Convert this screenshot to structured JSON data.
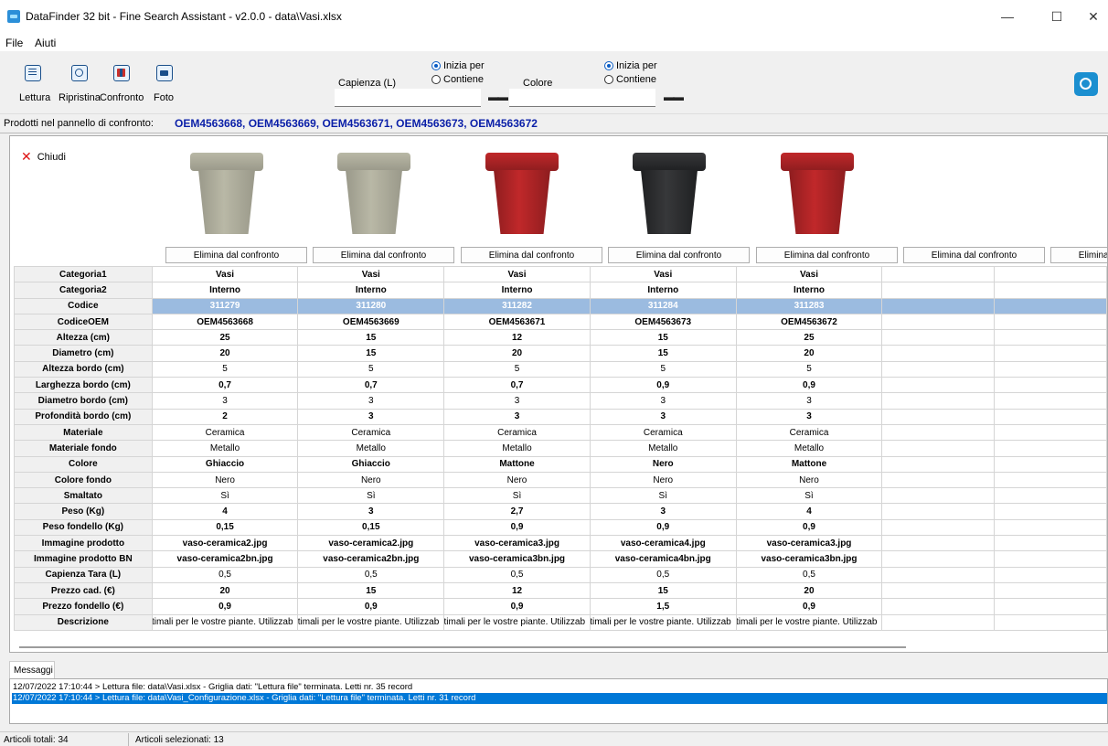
{
  "window": {
    "title": "DataFinder 32 bit - Fine Search Assistant - v2.0.0 - data\\Vasi.xlsx",
    "minimize": "—",
    "maximize": "☐",
    "close": "✕"
  },
  "menu": [
    "File",
    "Aiuti"
  ],
  "toolbar": {
    "buttons": [
      {
        "label": "Lettura",
        "icon": "reading-icon"
      },
      {
        "label": "Ripristina",
        "icon": "reset-icon"
      },
      {
        "label": "Confronto",
        "icon": "compare-icon"
      },
      {
        "label": "Foto",
        "icon": "photo-icon"
      }
    ],
    "search1": {
      "label": "Capienza (L)",
      "value": "",
      "radio1": "Inizia per",
      "radio2": "Contiene",
      "selected": "Inizia per"
    },
    "search2": {
      "label": "Colore",
      "value": "",
      "radio1": "Inizia per",
      "radio2": "Contiene",
      "selected": "Inizia per"
    },
    "binoculars": "👓"
  },
  "compare_bar": {
    "label": "Prodotti nel pannello di confronto:",
    "value": "OEM4563668, OEM4563669, OEM4563671, OEM4563673, OEM4563672"
  },
  "panel": {
    "close_label": "Chiudi",
    "close_icon": "✕",
    "remove_label": "Elimina dal confronto",
    "products": [
      {
        "color": "#b9b8a6",
        "dark": "#9a998a"
      },
      {
        "color": "#b9b8a6",
        "dark": "#9a998a"
      },
      {
        "color": "#c0282a",
        "dark": "#8e1d1f"
      },
      {
        "color": "#37383a",
        "dark": "#1f2022"
      },
      {
        "color": "#c0282a",
        "dark": "#8e1d1f"
      },
      null,
      null
    ],
    "rows": [
      {
        "label": "Categoria1",
        "style": "bold",
        "values": [
          "Vasi",
          "Vasi",
          "Vasi",
          "Vasi",
          "Vasi",
          "",
          ""
        ]
      },
      {
        "label": "Categoria2",
        "style": "bold",
        "values": [
          "Interno",
          "Interno",
          "Interno",
          "Interno",
          "Interno",
          "",
          ""
        ]
      },
      {
        "label": "Codice",
        "style": "sel",
        "values": [
          "311279",
          "311280",
          "311282",
          "311284",
          "311283",
          "",
          ""
        ]
      },
      {
        "label": "CodiceOEM",
        "style": "bold",
        "values": [
          "OEM4563668",
          "OEM4563669",
          "OEM4563671",
          "OEM4563673",
          "OEM4563672",
          "",
          ""
        ]
      },
      {
        "label": "Altezza (cm)",
        "style": "bold",
        "values": [
          "25",
          "15",
          "12",
          "15",
          "25",
          "",
          ""
        ]
      },
      {
        "label": "Diametro (cm)",
        "style": "bold",
        "values": [
          "20",
          "15",
          "20",
          "15",
          "20",
          "",
          ""
        ]
      },
      {
        "label": "Altezza bordo (cm)",
        "style": "normal",
        "values": [
          "5",
          "5",
          "5",
          "5",
          "5",
          "",
          ""
        ]
      },
      {
        "label": "Larghezza bordo (cm)",
        "style": "bold",
        "values": [
          "0,7",
          "0,7",
          "0,7",
          "0,9",
          "0,9",
          "",
          ""
        ]
      },
      {
        "label": "Diametro bordo (cm)",
        "style": "normal",
        "values": [
          "3",
          "3",
          "3",
          "3",
          "3",
          "",
          ""
        ]
      },
      {
        "label": "Profondità bordo (cm)",
        "style": "bold",
        "values": [
          "2",
          "3",
          "3",
          "3",
          "3",
          "",
          ""
        ]
      },
      {
        "label": "Materiale",
        "style": "normal",
        "values": [
          "Ceramica",
          "Ceramica",
          "Ceramica",
          "Ceramica",
          "Ceramica",
          "",
          ""
        ]
      },
      {
        "label": "Materiale fondo",
        "style": "normal",
        "values": [
          "Metallo",
          "Metallo",
          "Metallo",
          "Metallo",
          "Metallo",
          "",
          ""
        ]
      },
      {
        "label": "Colore",
        "style": "bold",
        "values": [
          "Ghiaccio",
          "Ghiaccio",
          "Mattone",
          "Nero",
          "Mattone",
          "",
          ""
        ]
      },
      {
        "label": "Colore fondo",
        "style": "normal",
        "values": [
          "Nero",
          "Nero",
          "Nero",
          "Nero",
          "Nero",
          "",
          ""
        ]
      },
      {
        "label": "Smaltato",
        "style": "normal",
        "values": [
          "Sì",
          "Sì",
          "Sì",
          "Sì",
          "Sì",
          "",
          ""
        ]
      },
      {
        "label": "Peso (Kg)",
        "style": "bold",
        "values": [
          "4",
          "3",
          "2,7",
          "3",
          "4",
          "",
          ""
        ]
      },
      {
        "label": "Peso fondello (Kg)",
        "style": "bold",
        "values": [
          "0,15",
          "0,15",
          "0,9",
          "0,9",
          "0,9",
          "",
          ""
        ]
      },
      {
        "label": "Immagine prodotto",
        "style": "bold",
        "values": [
          "vaso-ceramica2.jpg",
          "vaso-ceramica2.jpg",
          "vaso-ceramica3.jpg",
          "vaso-ceramica4.jpg",
          "vaso-ceramica3.jpg",
          "",
          ""
        ]
      },
      {
        "label": "Immagine prodotto BN",
        "style": "bold",
        "values": [
          "vaso-ceramica2bn.jpg",
          "vaso-ceramica2bn.jpg",
          "vaso-ceramica3bn.jpg",
          "vaso-ceramica4bn.jpg",
          "vaso-ceramica3bn.jpg",
          "",
          ""
        ]
      },
      {
        "label": "Capienza Tara (L)",
        "style": "normal",
        "values": [
          "0,5",
          "0,5",
          "0,5",
          "0,5",
          "0,5",
          "",
          ""
        ]
      },
      {
        "label": "Prezzo cad. (€)",
        "style": "bold",
        "values": [
          "20",
          "15",
          "12",
          "15",
          "20",
          "",
          ""
        ]
      },
      {
        "label": "Prezzo fondello (€)",
        "style": "bold",
        "values": [
          "0,9",
          "0,9",
          "0,9",
          "1,5",
          "0,9",
          "",
          ""
        ]
      },
      {
        "label": "Descrizione",
        "style": "desc",
        "values": [
          "ottimali per le vostre piante. Utilizzab",
          "ottimali per le vostre piante. Utilizzab",
          "ottimali per le vostre piante. Utilizzab",
          "ottimali per le vostre piante. Utilizzab",
          "ottimali per le vostre piante. Utilizzab",
          "",
          ""
        ]
      }
    ]
  },
  "messages": {
    "tab": "Messaggi",
    "lines": [
      "12/07/2022 17:10:44 > Lettura file: data\\Vasi.xlsx - Griglia dati: \"Lettura file\" terminata. Letti nr. 35 record",
      "12/07/2022 17:10:44 > Lettura file: data\\Vasi_Configurazione.xlsx - Griglia dati: \"Lettura file\" terminata. Letti nr. 31 record"
    ]
  },
  "status": {
    "total": "Articoli totali: 34",
    "selected": "Articoli selezionati: 13"
  }
}
